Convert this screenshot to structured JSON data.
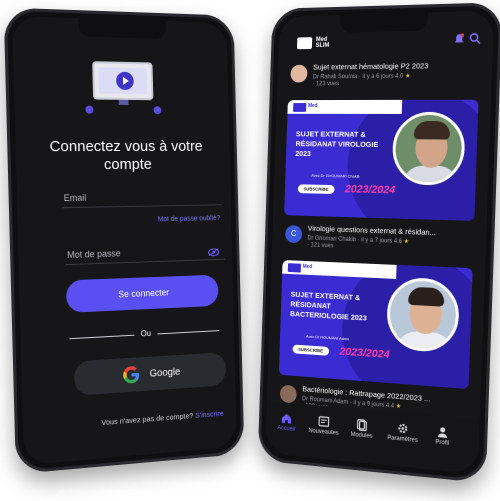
{
  "login": {
    "title": "Connectez vous à votre compte",
    "email_label": "Email",
    "forgot_password": "Mot de passe oublié?",
    "password_label": "Mot de passe",
    "login_button": "Se connecter",
    "or_text": "Ou",
    "google_button": "Google",
    "signup_prompt": "Vous n'avez pas de compte?",
    "signup_link": "S'inscrire"
  },
  "feed": {
    "brand_line1": "Med",
    "brand_line2": "SLIM",
    "videos": [
      {
        "title": "Sujet externat hématologie P2 2023",
        "author": "Dr Rahali Soumia",
        "meta": "· il y a 6 jours 4.0",
        "views": "· 123 vues"
      },
      {
        "title": "Virologie questions externat & résidan...",
        "author": "Dr Ghomari Chakib",
        "meta": "· il y a 7 jours 4.6",
        "views": "· 121 vues"
      },
      {
        "title": "Bactériologie : Rattrapage 2022/2023 ...",
        "author": "Dr Roumani Adam",
        "meta": "· il y a 9 jours 4.4",
        "views": "· 139 vues"
      }
    ],
    "thumbs": [
      {
        "logo_text": "Med",
        "title": "SUJET EXTERNAT & RÉSIDANAT VIROLOGIE 2023",
        "by": "Avec Dr GHOUMARI Chakib",
        "subscribe": "SUBSCRIBE",
        "year": "2023/2024"
      },
      {
        "logo_text": "Med",
        "title": "SUJET EXTERNAT & RÉSIDANAT BACTERIOLOGIE 2023",
        "by": "Avec Dr ROUMANI Adam",
        "subscribe": "SUBSCRIBE",
        "year": "2023/2024"
      }
    ],
    "avatar_letter": "C",
    "star": "★"
  },
  "tabs": [
    {
      "label": "Accueil",
      "icon": "home-icon"
    },
    {
      "label": "Nouveautes",
      "icon": "news-icon"
    },
    {
      "label": "Modules",
      "icon": "modules-icon"
    },
    {
      "label": "Paramètres",
      "icon": "gear-icon"
    },
    {
      "label": "Profil",
      "icon": "profile-icon"
    }
  ],
  "colors": {
    "accent": "#5a4ff0",
    "link": "#7b73ff",
    "thumb_bg": "#3a2bd3",
    "year": "#ff3da6"
  }
}
